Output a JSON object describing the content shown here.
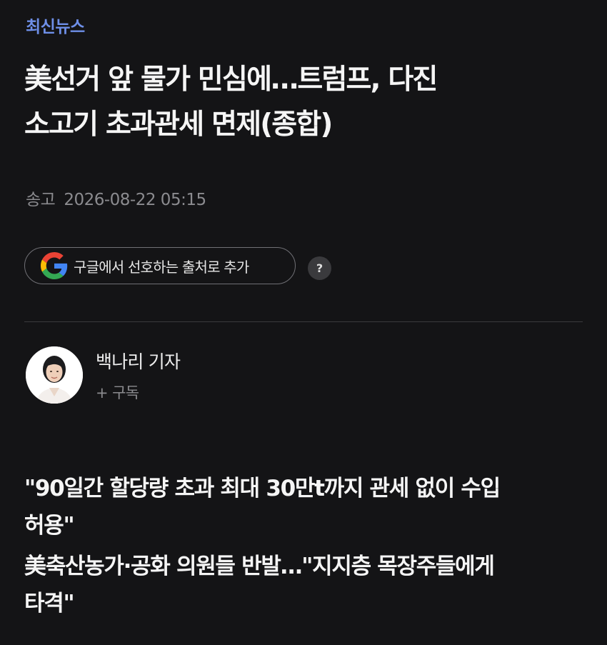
{
  "section": {
    "label": "최신뉴스",
    "color": "#6e8fe8"
  },
  "article": {
    "headline_lines": [
      "美선거 앞 물가 민심에…트럼프, 다진",
      "소고기 초과관세 면제(종합)"
    ],
    "dateline": {
      "label": "송고",
      "datetime": "2026-08-22 05:15"
    }
  },
  "google_preferred": {
    "label": "구글에서 선호하는 출처로 추가",
    "icon": "google-g-icon",
    "help_label": "?"
  },
  "reporter": {
    "name": "백나리 기자",
    "subscribe_label": "+ 구독",
    "avatar_icon": "reporter-avatar"
  },
  "subtitles": [
    {
      "lines": [
        "\"90일간 할당량 초과 최대 30만t까지 관세 없이 수입",
        "허용\""
      ]
    },
    {
      "lines": [
        "美축산농가·공화 의원들 반발…\"지지층 목장주들에게",
        "타격\""
      ]
    }
  ],
  "colors": {
    "background": "#141416",
    "text": "#f5f5f5",
    "muted": "#8b8b8f",
    "divider": "#3a3a3d"
  }
}
